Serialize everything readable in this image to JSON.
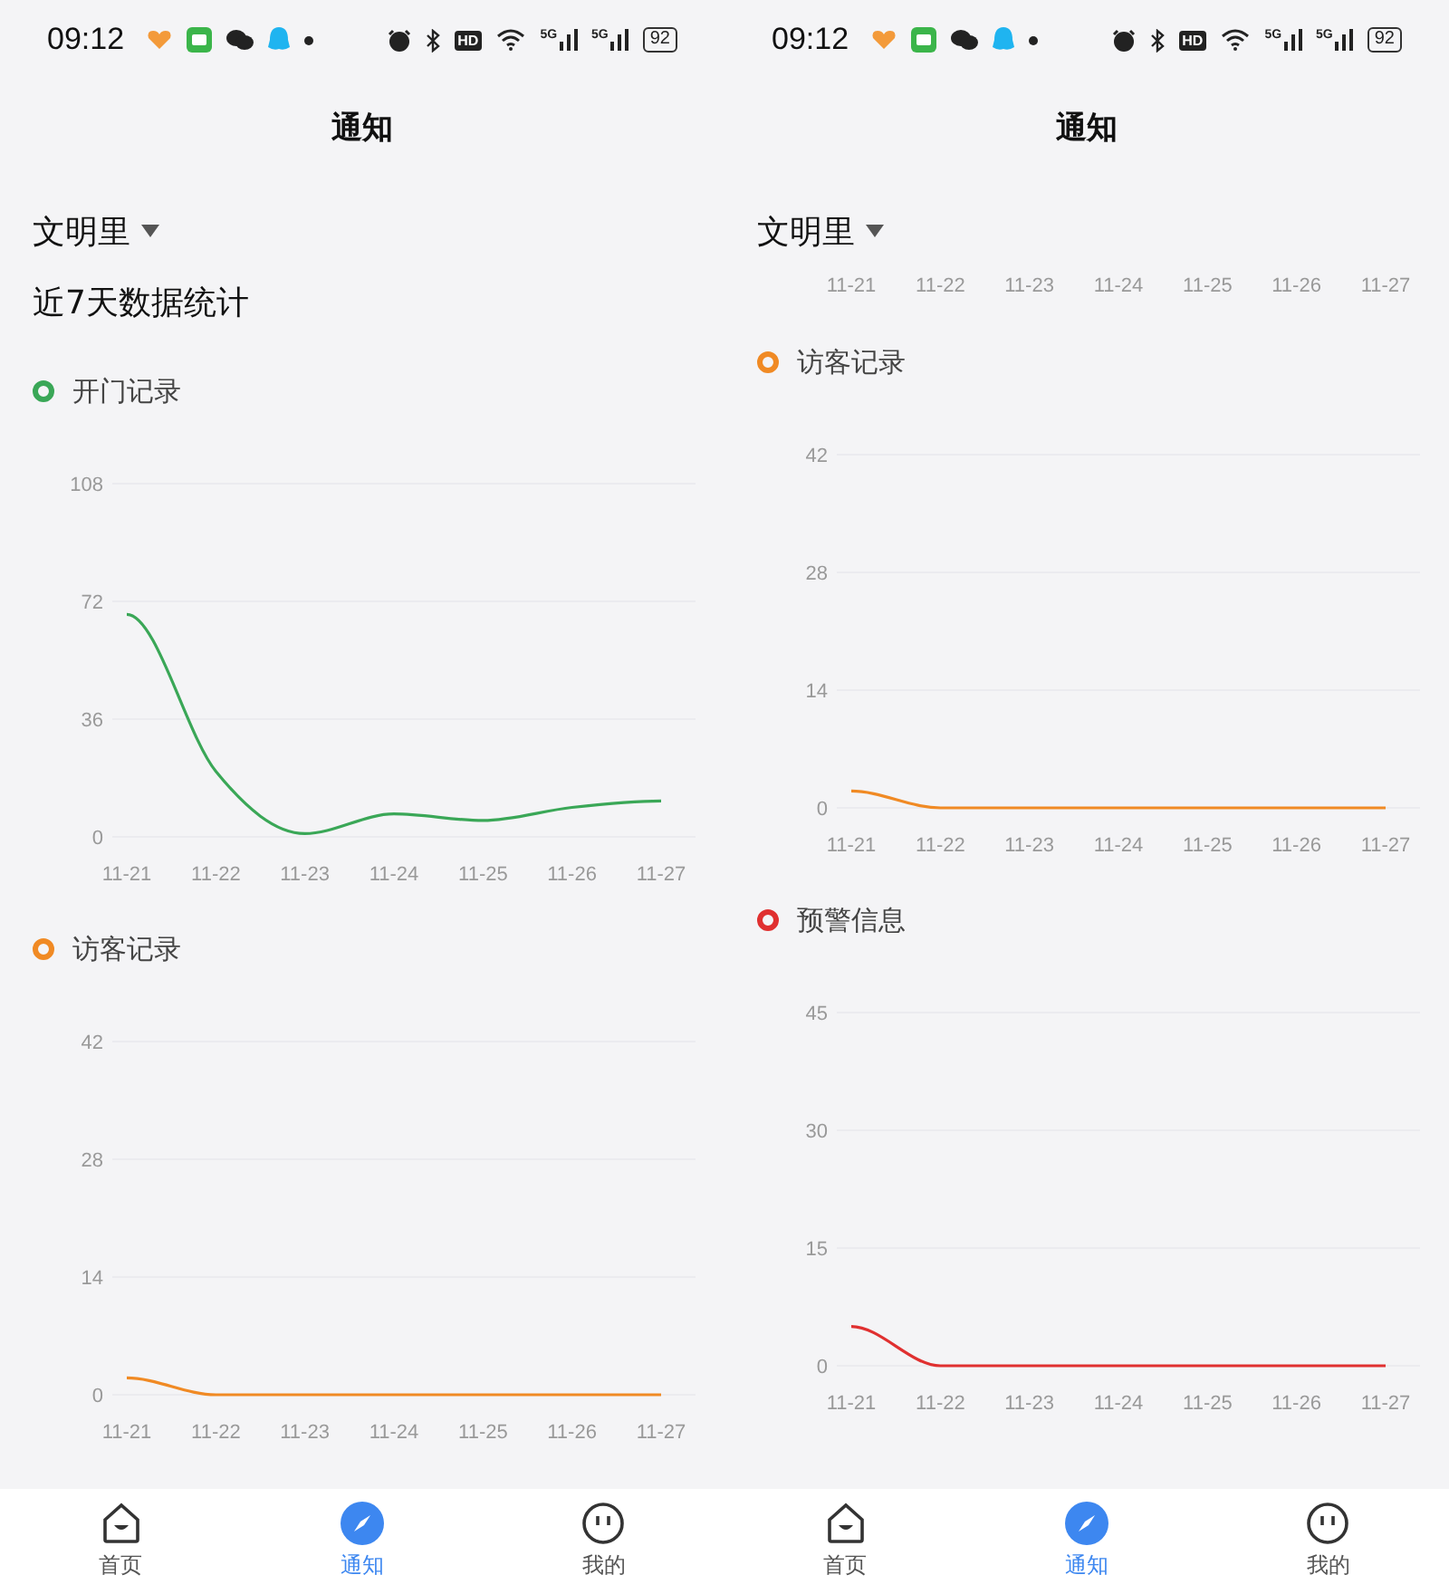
{
  "screens": [
    {
      "status_bar": {
        "time": "09:12",
        "hd": "HD",
        "signals": [
          "5G",
          "5G"
        ],
        "battery": "92"
      },
      "title": "通知",
      "location": "文明里",
      "section_title": "近7天数据统计",
      "charts": [
        {
          "chart_data": {
            "type": "line",
            "categories": [
              "11-21",
              "11-22",
              "11-23",
              "11-24",
              "11-25",
              "11-26",
              "11-27"
            ],
            "ylim": [
              0,
              108
            ],
            "yticks": [
              0,
              36,
              72,
              108
            ],
            "series": [
              {
                "name": "开门记录",
                "color": "#3aa757",
                "values": [
                  68,
                  20,
                  1,
                  7,
                  5,
                  9,
                  11
                ]
              }
            ]
          }
        },
        {
          "chart_data": {
            "type": "line",
            "categories": [
              "11-21",
              "11-22",
              "11-23",
              "11-24",
              "11-25",
              "11-26",
              "11-27"
            ],
            "ylim": [
              0,
              42
            ],
            "yticks": [
              0,
              14,
              28,
              42
            ],
            "series": [
              {
                "name": "访客记录",
                "color": "#f08a24",
                "values": [
                  2,
                  0,
                  0,
                  0,
                  0,
                  0,
                  0
                ]
              }
            ]
          }
        }
      ],
      "tabs": [
        {
          "label": "首页",
          "kind": "home",
          "selected": false
        },
        {
          "label": "通知",
          "kind": "compass",
          "selected": true
        },
        {
          "label": "我的",
          "kind": "face",
          "selected": false
        }
      ]
    },
    {
      "status_bar": {
        "time": "09:12",
        "hd": "HD",
        "signals": [
          "5G",
          "5G"
        ],
        "battery": "92"
      },
      "title": "通知",
      "location": "文明里",
      "cut_axis_labels": [
        "11-21",
        "11-22",
        "11-23",
        "11-24",
        "11-25",
        "11-26",
        "11-27"
      ],
      "charts": [
        {
          "chart_data": {
            "type": "line",
            "categories": [
              "11-21",
              "11-22",
              "11-23",
              "11-24",
              "11-25",
              "11-26",
              "11-27"
            ],
            "ylim": [
              0,
              42
            ],
            "yticks": [
              0,
              14,
              28,
              42
            ],
            "series": [
              {
                "name": "访客记录",
                "color": "#f08a24",
                "values": [
                  2,
                  0,
                  0,
                  0,
                  0,
                  0,
                  0
                ]
              }
            ]
          }
        },
        {
          "chart_data": {
            "type": "line",
            "categories": [
              "11-21",
              "11-22",
              "11-23",
              "11-24",
              "11-25",
              "11-26",
              "11-27"
            ],
            "ylim": [
              0,
              45
            ],
            "yticks": [
              0,
              15,
              30,
              45
            ],
            "series": [
              {
                "name": "预警信息",
                "color": "#e03030",
                "values": [
                  5,
                  0,
                  0,
                  0,
                  0,
                  0,
                  0
                ]
              }
            ]
          }
        }
      ],
      "tabs": [
        {
          "label": "首页",
          "kind": "home",
          "selected": false
        },
        {
          "label": "通知",
          "kind": "compass",
          "selected": true
        },
        {
          "label": "我的",
          "kind": "face",
          "selected": false
        }
      ]
    }
  ]
}
